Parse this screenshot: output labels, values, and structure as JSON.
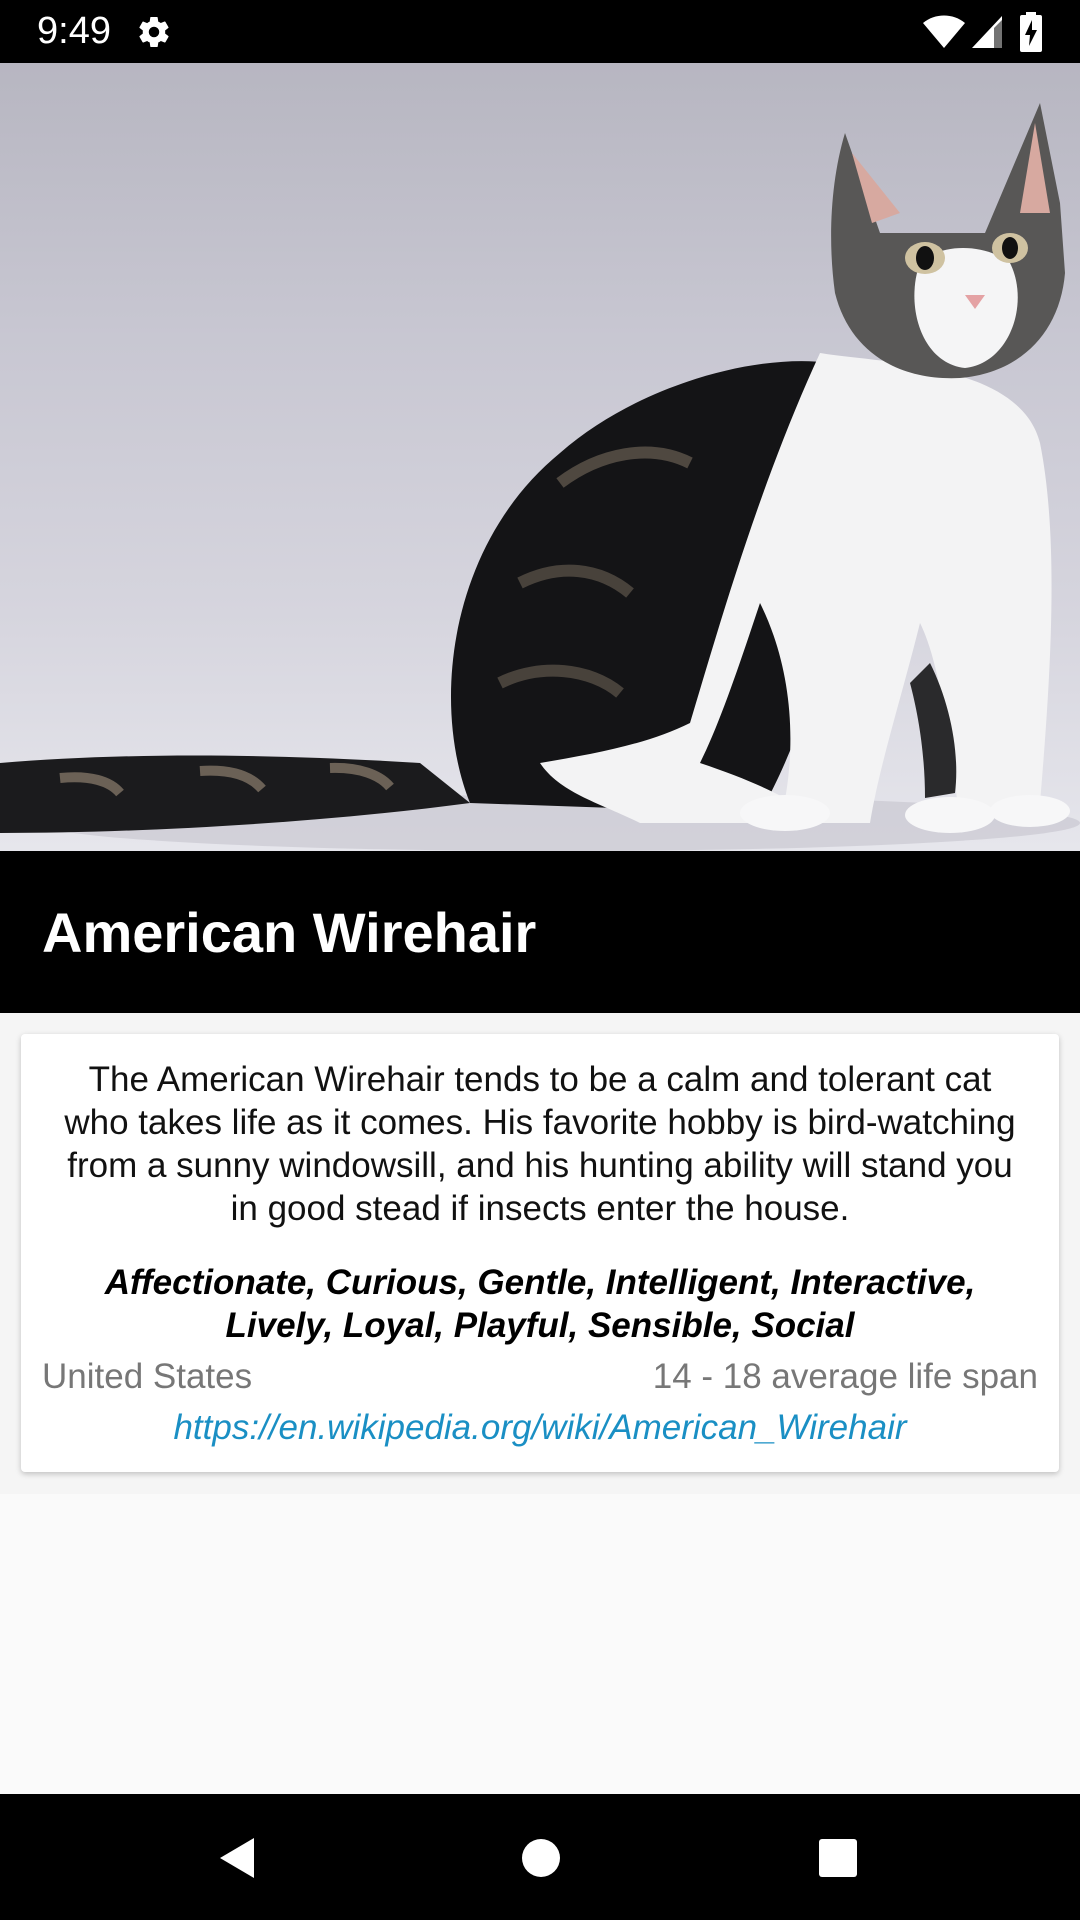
{
  "status_bar": {
    "time": "9:49",
    "icons": [
      "gear-icon",
      "wifi-icon",
      "signal-icon",
      "battery-icon"
    ]
  },
  "hero": {
    "image": "cat-photo"
  },
  "breed": {
    "name": "American Wirehair",
    "description": "The American Wirehair tends to be a calm and tolerant cat who takes life as it comes. His favorite hobby is bird-watching from a sunny windowsill, and his hunting ability will stand you in good stead if insects enter the house.",
    "temperament": "Affectionate, Curious, Gentle, Intelligent, Interactive, Lively, Loyal, Playful, Sensible, Social",
    "origin": "United States",
    "life_span": "14 - 18 average life span",
    "wikipedia_url": "https://en.wikipedia.org/wiki/American_Wirehair"
  },
  "nav_bar": {
    "icons": [
      "back-icon",
      "home-icon",
      "recents-icon"
    ]
  },
  "colors": {
    "link": "#1a8fc4",
    "title_band": "#000000",
    "secondary_text": "#777777"
  }
}
